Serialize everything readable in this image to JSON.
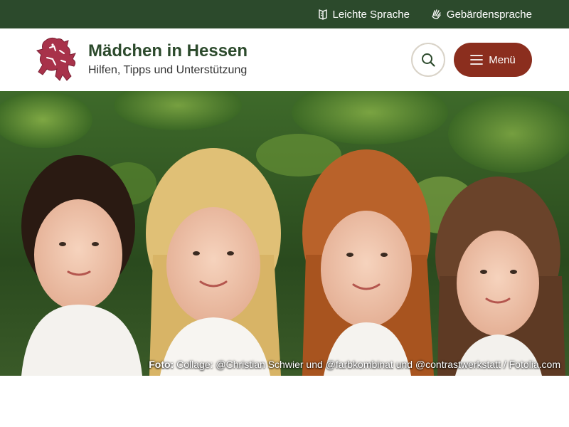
{
  "topbar": {
    "easy_language": "Leichte Sprache",
    "sign_language": "Gebärdensprache"
  },
  "header": {
    "title": "Mädchen in Hessen",
    "subtitle": "Hilfen, Tipps und Unterstützung",
    "menu_label": "Menü"
  },
  "hero": {
    "credit_label": "Foto:",
    "credit_text": "Collage: @Christian Schwier und @farbkombinat und @contrastwerkstatt / Fotolia.com"
  },
  "colors": {
    "topbar_bg": "#2c4a2c",
    "menu_button": "#8b2e1e",
    "title_green": "#2c4a2c",
    "lion_red": "#a8324a"
  },
  "icons": {
    "easy_language": "book-icon",
    "sign_language": "hand-icon",
    "search": "search-icon",
    "menu": "hamburger-icon",
    "logo": "hessian-lion-icon"
  }
}
